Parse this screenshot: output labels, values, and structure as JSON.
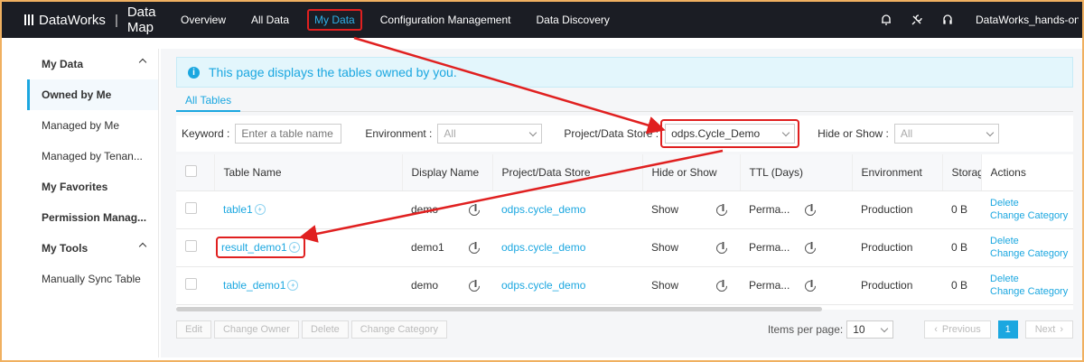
{
  "header": {
    "brand": "DataWorks",
    "product": "Data Map",
    "nav": [
      "Overview",
      "All Data",
      "My Data",
      "Configuration Management",
      "Data Discovery"
    ],
    "active_nav": "My Data",
    "user": "DataWorks_hands-on"
  },
  "sidebar": {
    "items": [
      {
        "label": "My Data",
        "type": "group"
      },
      {
        "label": "Owned by Me",
        "type": "selected"
      },
      {
        "label": "Managed by Me",
        "type": "item"
      },
      {
        "label": "Managed by Tenan...",
        "type": "item"
      },
      {
        "label": "My Favorites",
        "type": "group"
      },
      {
        "label": "Permission Manag...",
        "type": "group"
      },
      {
        "label": "My Tools",
        "type": "group"
      },
      {
        "label": "Manually Sync Table",
        "type": "item"
      }
    ]
  },
  "banner": {
    "icon": "info-icon",
    "text": "This page displays the tables owned by you."
  },
  "tabs": [
    "All Tables"
  ],
  "filters": {
    "keyword_label": "Keyword :",
    "keyword_placeholder": "Enter a table name or",
    "environment_label": "Environment :",
    "environment_value": "All",
    "project_label": "Project/Data Store :",
    "project_value": "odps.Cycle_Demo",
    "hide_label": "Hide or Show :",
    "hide_value": "All"
  },
  "table": {
    "columns": [
      "Table Name",
      "Display Name",
      "Project/Data Store",
      "Hide or Show",
      "TTL (Days)",
      "Environment",
      "Storage",
      "Actions"
    ],
    "rows": [
      {
        "name": "table1",
        "display": "demo",
        "project": "odps.cycle_demo",
        "hide": "Show",
        "ttl": "Perma...",
        "env": "Production",
        "storage": "0 B",
        "actions": [
          "Delete",
          "Change Category"
        ]
      },
      {
        "name": "result_demo1",
        "display": "demo1",
        "project": "odps.cycle_demo",
        "hide": "Show",
        "ttl": "Perma...",
        "env": "Production",
        "storage": "0 B",
        "actions": [
          "Delete",
          "Change Category"
        ]
      },
      {
        "name": "table_demo1",
        "display": "demo",
        "project": "odps.cycle_demo",
        "hide": "Show",
        "ttl": "Perma...",
        "env": "Production",
        "storage": "0 B",
        "actions": [
          "Delete",
          "Change Category"
        ]
      }
    ]
  },
  "bottom": {
    "buttons": [
      "Edit",
      "Change Owner",
      "Delete",
      "Change Category"
    ],
    "items_per_page_label": "Items per page:",
    "items_per_page_value": "10",
    "previous": "Previous",
    "page": "1",
    "next": "Next"
  },
  "colors": {
    "accent": "#1ba7e0",
    "highlight": "#e02020",
    "topbar": "#1b1d24"
  }
}
